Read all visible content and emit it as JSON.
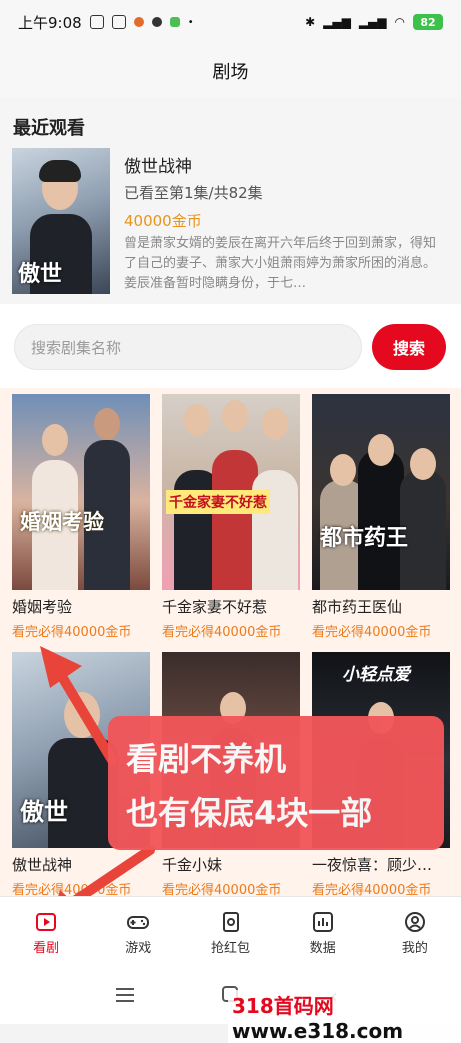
{
  "status_bar": {
    "time": "上午9:08",
    "battery": "82"
  },
  "header": {
    "title": "剧场"
  },
  "recent": {
    "heading": "最近观看",
    "title": "傲世战神",
    "progress": "已看至第1集/共82集",
    "coins": "40000金币",
    "description": "曾是萧家女婿的姜辰在离开六年后终于回到萧家，得知了自己的妻子、萧家大小姐萧雨婷为萧家所困的消息。姜辰准备暂时隐瞒身份，于七…",
    "poster_text": "傲世"
  },
  "search": {
    "placeholder": "搜索剧集名称",
    "button": "搜索"
  },
  "dramas": [
    {
      "title": "婚姻考验",
      "reward": "看完必得40000金币",
      "poster_text": "婚姻考验"
    },
    {
      "title": "千金家妻不好惹",
      "reward": "看完必得40000金币",
      "poster_text": "千金家妻不好惹"
    },
    {
      "title": "都市药王医仙",
      "reward": "看完必得40000金币",
      "poster_text": "都市药王"
    },
    {
      "title": "傲世战神",
      "reward": "看完必得40000金币",
      "poster_text": "傲世"
    },
    {
      "title": "千金小妹",
      "reward": "看完必得40000金币",
      "poster_text": ""
    },
    {
      "title": "一夜惊喜：顾少…",
      "reward": "看完必得40000金币",
      "poster_text": "小轻点爱"
    }
  ],
  "overlay": {
    "line1": "看剧不养机",
    "line2": "也有保底4块一部"
  },
  "tabs": [
    {
      "label": "看剧",
      "icon": "play-icon"
    },
    {
      "label": "游戏",
      "icon": "gamepad-icon"
    },
    {
      "label": "抢红包",
      "icon": "red-packet-icon"
    },
    {
      "label": "数据",
      "icon": "bar-chart-icon"
    },
    {
      "label": "我的",
      "icon": "profile-icon"
    }
  ],
  "watermark": {
    "prefix": "318首码网",
    "suffix": "www.e318.com"
  },
  "colors": {
    "accent": "#e5091f",
    "reward": "#ec7b1c",
    "banner": "#f2565a"
  }
}
